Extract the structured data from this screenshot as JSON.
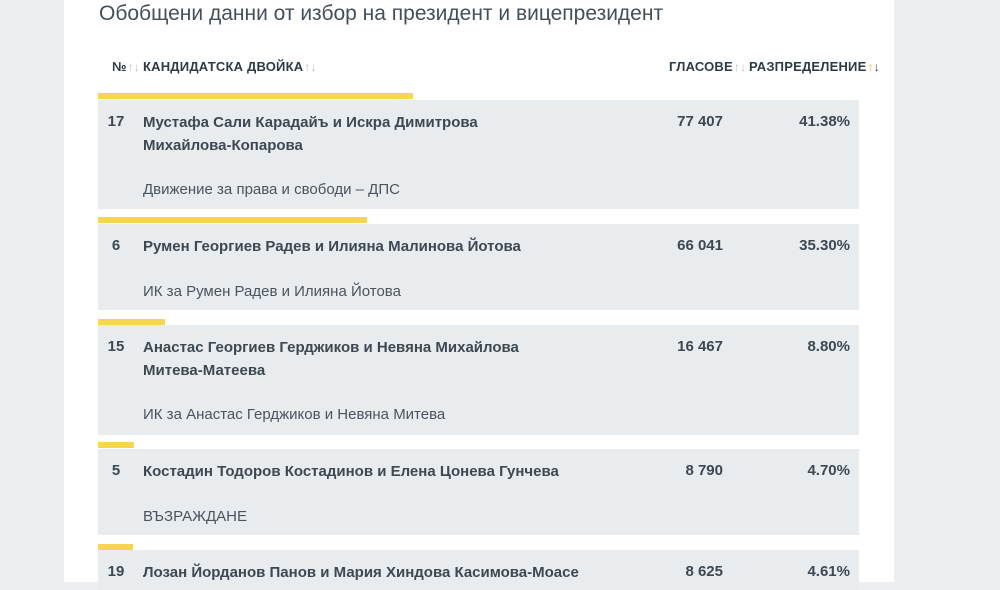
{
  "page_title": "Обобщени данни от избор на президент и вицепрезидент",
  "columns": {
    "num": "№",
    "candidates": "КАНДИДАТСКА ДВОЙКА",
    "votes": "ГЛАСОВЕ",
    "distribution": "РАЗПРЕДЕЛЕНИЕ"
  },
  "sort_icons": {
    "inactive": "⇅",
    "active_column": "distribution",
    "up_glyph": "↑",
    "down_glyph": "↓"
  },
  "colors": {
    "accent_bar": "#f7d54f",
    "row_bg": "#e9ecee",
    "text": "#3d4852"
  },
  "rows": [
    {
      "num": "17",
      "name": "Мустафа Сали Карадайъ и Искра Димитрова Михайлова-Копарова",
      "party": "Движение за права и свободи – ДПС",
      "votes": "77 407",
      "pct": "41.38%",
      "share": 0.4138
    },
    {
      "num": "6",
      "name": "Румен Георгиев Радев и Илияна Малинова Йотова",
      "party": "ИК за Румен Радев и Илияна Йотова",
      "votes": "66 041",
      "pct": "35.30%",
      "share": 0.353
    },
    {
      "num": "15",
      "name": "Анастас Георгиев Герджиков и Невяна Михайлова Митева-Матеева",
      "party": "ИК за Анастас Герджиков и Невяна Митева",
      "votes": "16 467",
      "pct": "8.80%",
      "share": 0.088
    },
    {
      "num": "5",
      "name": "Костадин Тодоров Костадинов и Елена Цонева Гунчева",
      "party": "ВЪЗРАЖДАНЕ",
      "votes": "8 790",
      "pct": "4.70%",
      "share": 0.047
    },
    {
      "num": "19",
      "name": "Лозан Йорданов Панов и Мария Хиндова Касимова-Моасе",
      "party": "",
      "votes": "8 625",
      "pct": "4.61%",
      "share": 0.0461
    }
  ]
}
